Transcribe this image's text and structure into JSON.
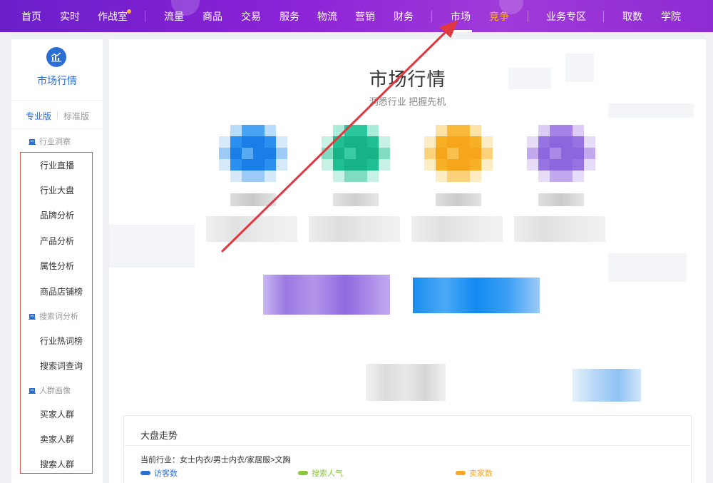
{
  "nav": {
    "items": [
      "首页",
      "实时",
      "作战室",
      "流量",
      "商品",
      "交易",
      "服务",
      "物流",
      "营销",
      "财务",
      "市场",
      "竞争",
      "业务专区",
      "取数",
      "学院"
    ],
    "active": "市场",
    "highlight": "竞争"
  },
  "sidebar": {
    "title": "市场行情",
    "tabs": {
      "pro": "专业版",
      "std": "标准版"
    },
    "groups": {
      "g1": "行业洞察",
      "g2": "搜索词分析",
      "g3": "人群画像"
    },
    "items": [
      "行业直播",
      "行业大盘",
      "品牌分析",
      "产品分析",
      "属性分析",
      "商品店铺榜",
      "行业热词榜",
      "搜索词查询",
      "买家人群",
      "卖家人群",
      "搜索人群"
    ]
  },
  "main": {
    "title": "市场行情",
    "subtitle": "洞悉行业 把握先机",
    "panel": {
      "title": "大盘走势",
      "path": "当前行业：女士内衣/男士内衣/家居服>文胸",
      "legend": [
        "访客数",
        "搜索人气",
        "卖家数"
      ]
    }
  },
  "colors": {
    "nav_from": "#6a1fc9",
    "nav_to": "#a03ad9",
    "accent_blue": "#2b6fd6",
    "accent_orange": "#ffb02e",
    "annotation_red": "#e0383e",
    "legend_blue": "#2b6fd6",
    "legend_green": "#8cc63f",
    "legend_orange": "#f5a623"
  }
}
